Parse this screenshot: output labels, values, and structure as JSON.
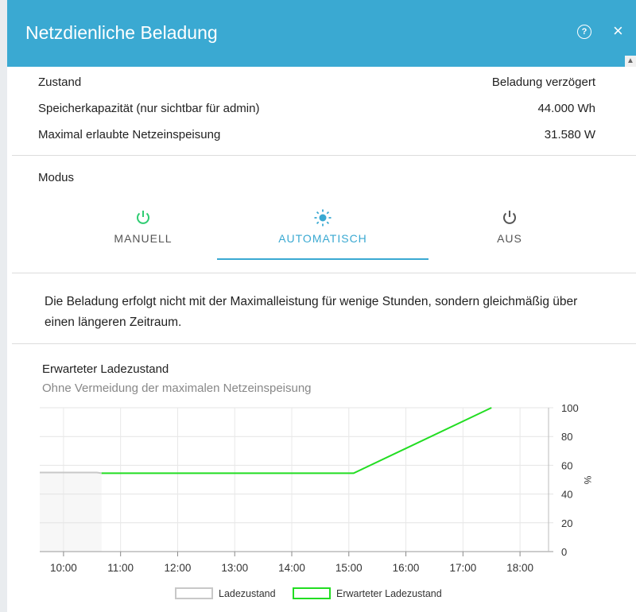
{
  "dialog": {
    "title": "Netzdienliche Beladung",
    "help_icon": "question-circle-icon",
    "close_icon": "close-icon"
  },
  "info": [
    {
      "label": "Zustand",
      "value": "Beladung verzögert"
    },
    {
      "label": "Speicherkapazität (nur sichtbar für admin)",
      "value": "44.000 Wh"
    },
    {
      "label": "Maximal erlaubte Netzeinspeisung",
      "value": "31.580 W"
    }
  ],
  "modus": {
    "label": "Modus",
    "options": [
      {
        "label": "MANUELL",
        "icon": "power-icon",
        "icon_color": "#2ecc71"
      },
      {
        "label": "AUTOMATISCH",
        "icon": "sun-icon",
        "icon_color": "#3aa9d2",
        "selected": true
      },
      {
        "label": "AUS",
        "icon": "power-icon",
        "icon_color": "#555555"
      }
    ]
  },
  "description": "Die Beladung erfolgt nicht mit der Maximalleistung für wenige Stunden, sondern gleichmäßig über einen längeren Zeitraum.",
  "chart_section": {
    "title": "Erwarteter Ladezustand",
    "subtitle": "Ohne Vermeidung der maximalen Netzeinspeisung"
  },
  "chart_data": {
    "type": "line",
    "x_ticks": [
      "10:00",
      "11:00",
      "12:00",
      "13:00",
      "14:00",
      "15:00",
      "16:00",
      "17:00",
      "18:00"
    ],
    "xlim": [
      "09:35",
      "18:30"
    ],
    "ylabel": "%",
    "ylim": [
      0,
      100
    ],
    "y_ticks": [
      0,
      20,
      40,
      60,
      80,
      100
    ],
    "grid": true,
    "legend_position": "bottom",
    "series": [
      {
        "name": "Ladezustand",
        "color": "#c8c8c8",
        "fill": "#f7f7f7",
        "points": [
          [
            "09:35",
            55
          ],
          [
            "10:35",
            55
          ],
          [
            "10:40",
            54.5
          ]
        ]
      },
      {
        "name": "Erwarteter Ladezustand",
        "color": "#22dd22",
        "points": [
          [
            "10:40",
            54.5
          ],
          [
            "15:05",
            54.5
          ],
          [
            "17:30",
            100
          ]
        ]
      }
    ]
  }
}
